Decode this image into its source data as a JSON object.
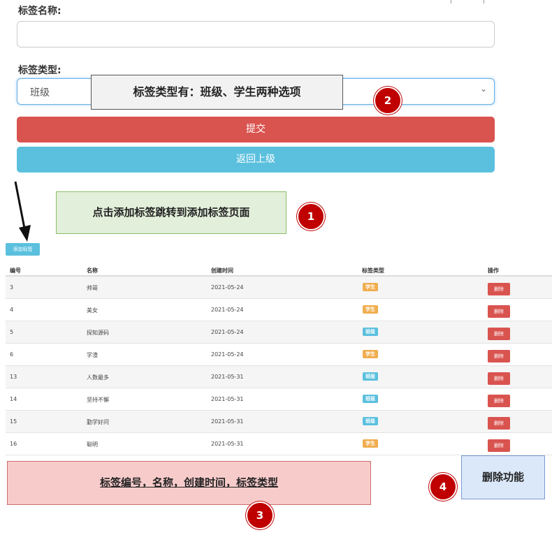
{
  "form": {
    "name_label": "标签名称:",
    "name_value": "",
    "type_label": "标签类型:",
    "type_selected": "班级",
    "submit_label": "提交",
    "back_label": "返回上级"
  },
  "annotations": {
    "note_2": "标签类型有：班级、学生两种选项",
    "note_1": "点击添加标签跳转到添加标签页面",
    "note_3": "标签编号，名称，创建时间，标签类型",
    "note_4": "删除功能",
    "badge_1": "1",
    "badge_2": "2",
    "badge_3": "3",
    "badge_4": "4"
  },
  "list": {
    "add_button_label": "添加标签",
    "columns": [
      "编号",
      "名称",
      "创建时间",
      "标签类型",
      "操作"
    ],
    "delete_label": "删除",
    "rows": [
      {
        "id": "3",
        "name": "帅哥",
        "created": "2021-05-24",
        "type": "学生"
      },
      {
        "id": "4",
        "name": "美女",
        "created": "2021-05-24",
        "type": "学生"
      },
      {
        "id": "5",
        "name": "探知源码",
        "created": "2021-05-24",
        "type": "班级"
      },
      {
        "id": "6",
        "name": "学渣",
        "created": "2021-05-24",
        "type": "学生"
      },
      {
        "id": "13",
        "name": "人数最多",
        "created": "2021-05-31",
        "type": "班级"
      },
      {
        "id": "14",
        "name": "坚持不懈",
        "created": "2021-05-31",
        "type": "班级"
      },
      {
        "id": "15",
        "name": "勤学好问",
        "created": "2021-05-31",
        "type": "班级"
      },
      {
        "id": "16",
        "name": "聪明",
        "created": "2021-05-31",
        "type": "学生"
      }
    ]
  },
  "colors": {
    "danger": "#d9534f",
    "info": "#5bc0de",
    "warning": "#f0ad4e",
    "badge": "#c00000"
  },
  "icons": {
    "select_arrow": "chevron-down-icon",
    "pointer": "arrow-down-icon"
  }
}
